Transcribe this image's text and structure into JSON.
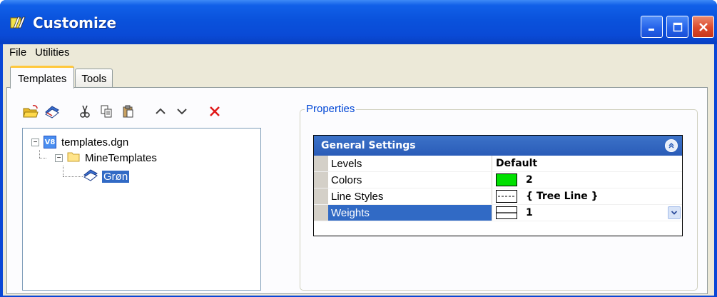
{
  "window": {
    "title": "Customize"
  },
  "menu": {
    "items": [
      "File",
      "Utilities"
    ]
  },
  "tabs": [
    {
      "label": "Templates",
      "active": true
    },
    {
      "label": "Tools",
      "active": false
    }
  ],
  "toolbar": {
    "icons": [
      "open-folder-icon",
      "template-icon",
      "cut-icon",
      "copy-icon",
      "paste-icon",
      "move-up-icon",
      "move-down-icon",
      "delete-icon"
    ]
  },
  "tree": {
    "root": {
      "label": "templates.dgn",
      "icon": "v8-file-icon",
      "expander": "⊟"
    },
    "folder": {
      "label": "MineTemplates",
      "icon": "folder-icon",
      "expander": "⊟"
    },
    "leaf": {
      "label": "Grøn",
      "icon": "template-icon",
      "selected": true
    }
  },
  "properties": {
    "legend": "Properties",
    "section_title": "General Settings",
    "rows": [
      {
        "name": "Levels",
        "value": "Default"
      },
      {
        "name": "Colors",
        "value": "2",
        "swatch_color": "#00e000"
      },
      {
        "name": "Line Styles",
        "value": "{ Tree Line }"
      },
      {
        "name": "Weights",
        "value": "1",
        "selected": true
      }
    ]
  },
  "colors": {
    "titlebar": "#0a4ad6",
    "selection": "#316ac5",
    "accent_tab": "#ffc83c",
    "legend_text": "#0046d5"
  }
}
